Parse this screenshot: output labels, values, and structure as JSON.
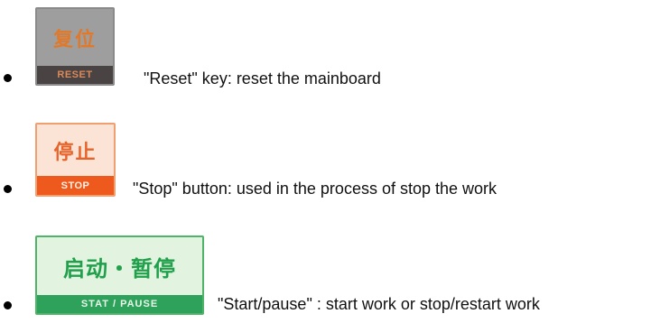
{
  "items": [
    {
      "key_top": "复位",
      "key_bottom": "RESET",
      "description": "\"Reset\" key: reset the mainboard"
    },
    {
      "key_top": "停止",
      "key_bottom": "STOP",
      "description": "\"Stop\" button: used in the process of stop the work"
    },
    {
      "key_top": "启动・暂停",
      "key_bottom": "STAT / PAUSE",
      "description": "\"Start/pause\" : start work or stop/restart work"
    }
  ],
  "colors": {
    "reset_key": "#9e9e9e",
    "stop_key": "#ee5a1e",
    "start_key": "#2ea25a"
  },
  "icons": {
    "bullet": "black-dot-bullet"
  }
}
